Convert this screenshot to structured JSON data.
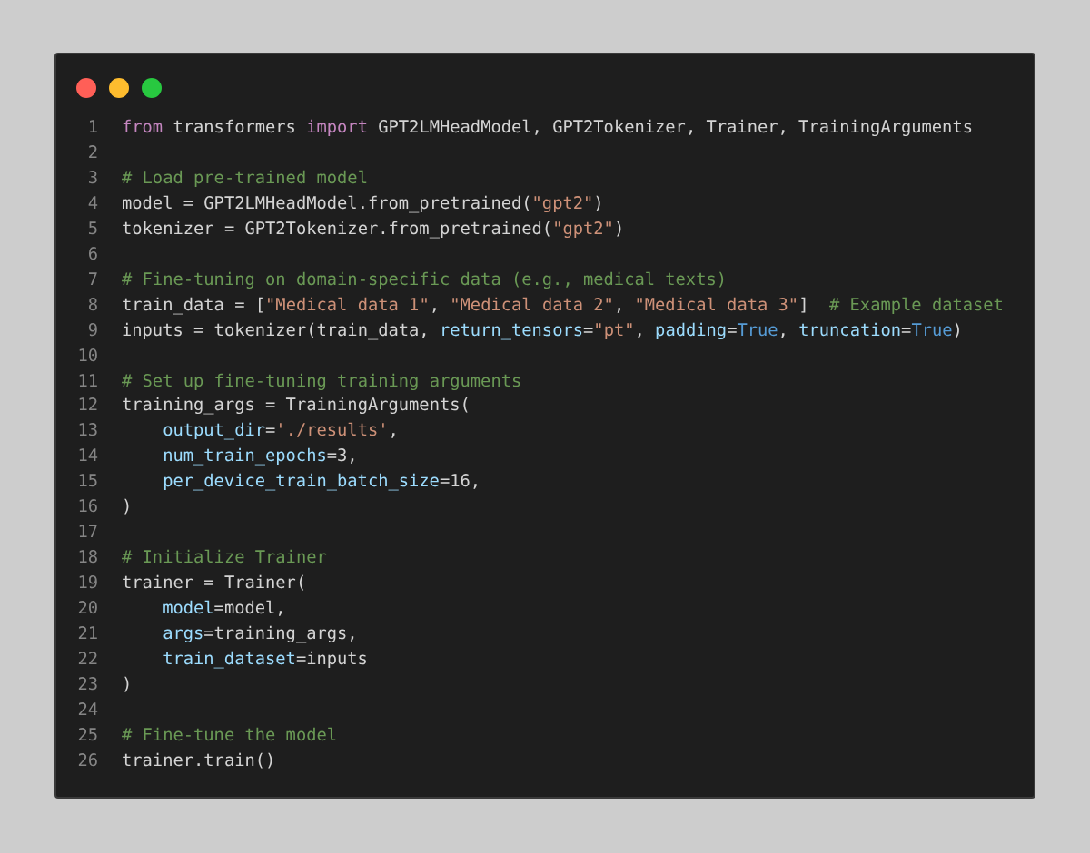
{
  "window_controls": [
    {
      "color": "#ff5f57"
    },
    {
      "color": "#febc2e"
    },
    {
      "color": "#28c840"
    }
  ],
  "lines": [
    {
      "number": "1",
      "tokens": [
        {
          "kind": "keyword",
          "text": "from"
        },
        {
          "kind": "plain",
          "text": " transformers "
        },
        {
          "kind": "keyword",
          "text": "import"
        },
        {
          "kind": "plain",
          "text": " GPT2LMHeadModel, GPT2Tokenizer, Trainer, TrainingArguments"
        }
      ]
    },
    {
      "number": "2"
    },
    {
      "number": "3",
      "tokens": [
        {
          "kind": "comment",
          "text": "# Load pre-trained model"
        }
      ]
    },
    {
      "number": "4",
      "tokens": [
        {
          "kind": "plain",
          "text": "model = GPT2LMHeadModel.from_pretrained("
        },
        {
          "kind": "string",
          "text": "\"gpt2\""
        },
        {
          "kind": "plain",
          "text": ")"
        }
      ]
    },
    {
      "number": "5",
      "tokens": [
        {
          "kind": "plain",
          "text": "tokenizer = GPT2Tokenizer.from_pretrained("
        },
        {
          "kind": "string",
          "text": "\"gpt2\""
        },
        {
          "kind": "plain",
          "text": ")"
        }
      ]
    },
    {
      "number": "6"
    },
    {
      "number": "7",
      "tokens": [
        {
          "kind": "comment",
          "text": "# Fine-tuning on domain-specific data (e.g., medical texts)"
        }
      ]
    },
    {
      "number": "8",
      "tokens": [
        {
          "kind": "plain",
          "text": "train_data = ["
        },
        {
          "kind": "string",
          "text": "\"Medical data 1\""
        },
        {
          "kind": "plain",
          "text": ", "
        },
        {
          "kind": "string",
          "text": "\"Medical data 2\""
        },
        {
          "kind": "plain",
          "text": ", "
        },
        {
          "kind": "string",
          "text": "\"Medical data 3\""
        },
        {
          "kind": "plain",
          "text": "]  "
        },
        {
          "kind": "comment",
          "text": "# Example dataset"
        }
      ]
    },
    {
      "number": "9",
      "tokens": [
        {
          "kind": "plain",
          "text": "inputs = tokenizer(train_data, "
        },
        {
          "kind": "param",
          "text": "return_tensors"
        },
        {
          "kind": "plain",
          "text": "="
        },
        {
          "kind": "string",
          "text": "\"pt\""
        },
        {
          "kind": "plain",
          "text": ", "
        },
        {
          "kind": "param",
          "text": "padding"
        },
        {
          "kind": "plain",
          "text": "="
        },
        {
          "kind": "constant",
          "text": "True"
        },
        {
          "kind": "plain",
          "text": ", "
        },
        {
          "kind": "param",
          "text": "truncation"
        },
        {
          "kind": "plain",
          "text": "="
        },
        {
          "kind": "constant",
          "text": "True"
        },
        {
          "kind": "plain",
          "text": ")"
        }
      ]
    },
    {
      "number": "10"
    },
    {
      "number": "11",
      "tokens": [
        {
          "kind": "comment",
          "text": "# Set up fine-tuning training arguments"
        }
      ]
    },
    {
      "number": "12",
      "tokens": [
        {
          "kind": "plain",
          "text": "training_args = TrainingArguments("
        }
      ]
    },
    {
      "number": "13",
      "indented": true,
      "tokens": [
        {
          "kind": "param",
          "text": "output_dir"
        },
        {
          "kind": "plain",
          "text": "="
        },
        {
          "kind": "string",
          "text": "'./results'"
        },
        {
          "kind": "plain",
          "text": ","
        }
      ]
    },
    {
      "number": "14",
      "indented": true,
      "tokens": [
        {
          "kind": "param",
          "text": "num_train_epochs"
        },
        {
          "kind": "plain",
          "text": "=3,"
        }
      ]
    },
    {
      "number": "15",
      "indented": true,
      "tokens": [
        {
          "kind": "param",
          "text": "per_device_train_batch_size"
        },
        {
          "kind": "plain",
          "text": "=16,"
        }
      ]
    },
    {
      "number": "16",
      "tokens": [
        {
          "kind": "plain",
          "text": ")"
        }
      ]
    },
    {
      "number": "17"
    },
    {
      "number": "18",
      "tokens": [
        {
          "kind": "comment",
          "text": "# Initialize Trainer"
        }
      ]
    },
    {
      "number": "19",
      "tokens": [
        {
          "kind": "plain",
          "text": "trainer = Trainer("
        }
      ]
    },
    {
      "number": "20",
      "indented": true,
      "tokens": [
        {
          "kind": "param",
          "text": "model"
        },
        {
          "kind": "plain",
          "text": "=model,"
        }
      ]
    },
    {
      "number": "21",
      "indented": true,
      "tokens": [
        {
          "kind": "param",
          "text": "args"
        },
        {
          "kind": "plain",
          "text": "=training_args,"
        }
      ]
    },
    {
      "number": "22",
      "indented": true,
      "tokens": [
        {
          "kind": "param",
          "text": "train_dataset"
        },
        {
          "kind": "plain",
          "text": "=inputs"
        }
      ]
    },
    {
      "number": "23",
      "tokens": [
        {
          "kind": "plain",
          "text": ")"
        }
      ]
    },
    {
      "number": "24"
    },
    {
      "number": "25",
      "tokens": [
        {
          "kind": "comment",
          "text": "# Fine-tune the model"
        }
      ]
    },
    {
      "number": "26",
      "tokens": [
        {
          "kind": "plain",
          "text": "trainer.train()"
        }
      ]
    }
  ]
}
